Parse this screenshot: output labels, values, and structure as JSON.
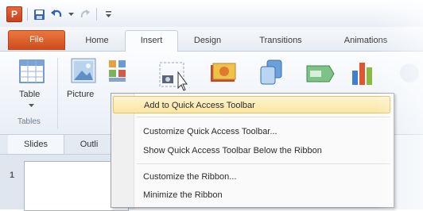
{
  "app": {
    "icon_letter": "P",
    "accent": "#d24b1e"
  },
  "quick_access": {
    "icons": [
      "save-icon",
      "undo-icon",
      "redo-icon",
      "customize-dropdown-icon"
    ]
  },
  "tabs": [
    {
      "label": "File",
      "active": false
    },
    {
      "label": "Home",
      "active": false
    },
    {
      "label": "Insert",
      "active": true
    },
    {
      "label": "Design",
      "active": false
    },
    {
      "label": "Transitions",
      "active": false
    },
    {
      "label": "Animations",
      "active": false
    }
  ],
  "ribbon": {
    "table_label": "Table",
    "picture_label": "Picture",
    "group_label": "Tables"
  },
  "panel": {
    "slides_tab": "Slides",
    "outline_tab": "Outli",
    "slide_number": "1"
  },
  "context_menu": {
    "items": [
      "Add to Quick Access Toolbar",
      "Customize Quick Access Toolbar...",
      "Show Quick Access Toolbar Below the Ribbon",
      "Customize the Ribbon...",
      "Minimize the Ribbon"
    ],
    "highlighted_index": 0
  }
}
